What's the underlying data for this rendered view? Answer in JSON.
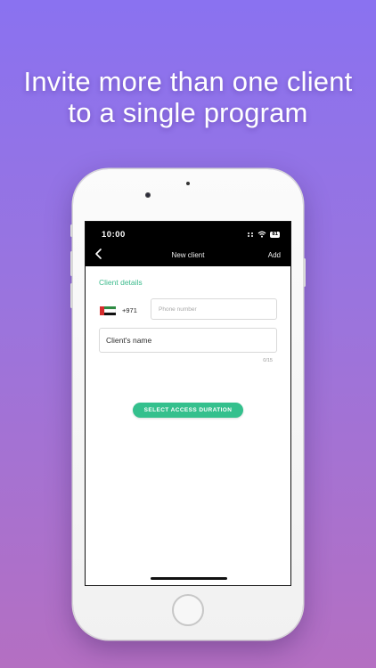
{
  "headline": {
    "line1": "Invite more than one client",
    "line2": "to a single program"
  },
  "status_bar": {
    "time": "10:00",
    "battery_level": "81",
    "icons": [
      "signal-dots-icon",
      "wifi-icon",
      "battery-icon"
    ]
  },
  "nav": {
    "back_icon": "chevron-left-icon",
    "title": "New client",
    "action": "Add"
  },
  "form": {
    "section_label": "Client details",
    "country_flag": "uae-flag-icon",
    "country_code": "+971",
    "phone_placeholder": "Phone number",
    "name_placeholder": "Client's name",
    "name_counter": "0/15"
  },
  "cta": {
    "label": "SELECT ACCESS DURATION"
  },
  "colors": {
    "accent": "#34c08d",
    "background_top": "#8a72f0",
    "background_bottom": "#b46fc2",
    "topbar": "#000000"
  }
}
